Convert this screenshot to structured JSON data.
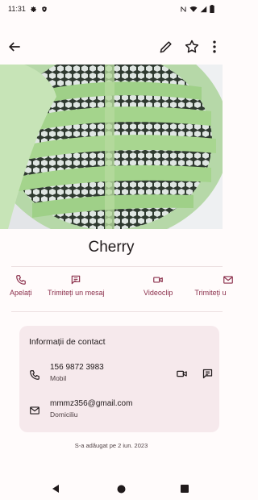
{
  "status_bar": {
    "time": "11:31",
    "icons_left": [
      "settings-icon",
      "shield-icon"
    ],
    "icons_right": [
      "nfc-icon",
      "wifi-icon",
      "signal-icon",
      "battery-icon"
    ]
  },
  "toolbar": {
    "back_icon": "arrow-back-icon",
    "edit_icon": "edit-pencil-icon",
    "favorite_icon": "star-outline-icon",
    "more_icon": "more-vert-icon"
  },
  "contact": {
    "name": "Cherry"
  },
  "actions": [
    {
      "label": "Apelați",
      "icon": "phone-icon"
    },
    {
      "label": "Trimiteți un mesaj",
      "icon": "message-icon"
    },
    {
      "label": "Videoclip",
      "icon": "videocam-icon"
    },
    {
      "label": "Trimiteți u",
      "icon": "email-icon"
    }
  ],
  "contact_info": {
    "title": "Informații de contact",
    "phone": {
      "number": "156 9872 3983",
      "type": "Mobil"
    },
    "email": {
      "address": "mmmz356@gmail.com",
      "type": "Domiciliu"
    }
  },
  "added_text": "S-a adăugat pe 2 iun. 2023",
  "colors": {
    "accent": "#8b2f4b",
    "card_bg": "#f6e9ec",
    "background": "#fffbfb"
  }
}
